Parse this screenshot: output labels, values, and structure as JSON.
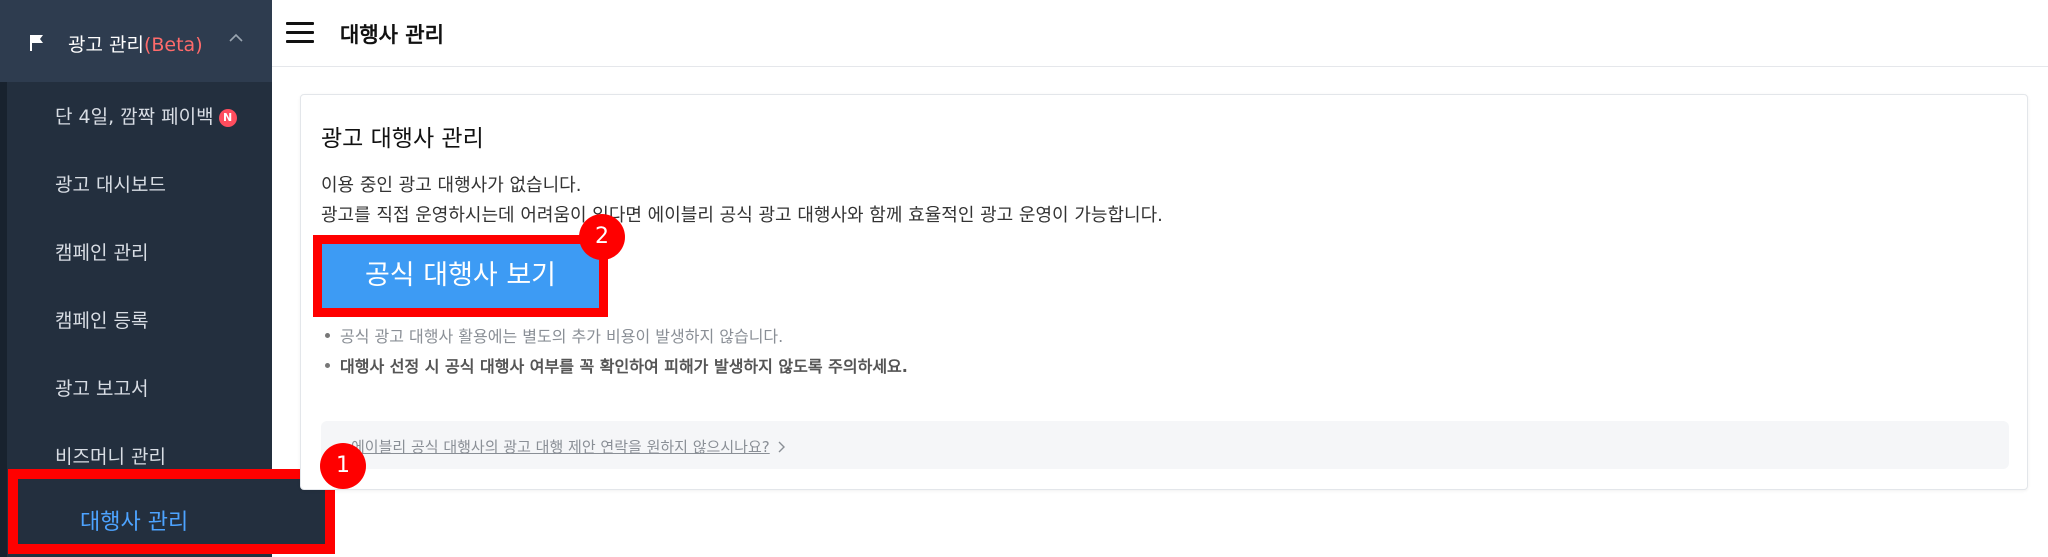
{
  "sidebar": {
    "section_title": "광고 관리",
    "section_badge": "(Beta)",
    "items": [
      {
        "label": "단 4일, 깜짝 페이백",
        "badge": "N"
      },
      {
        "label": "광고 대시보드"
      },
      {
        "label": "캠페인 관리"
      },
      {
        "label": "캠페인 등록"
      },
      {
        "label": "광고 보고서"
      },
      {
        "label": "비즈머니 관리"
      }
    ],
    "active_item": "대행사 관리"
  },
  "header": {
    "title": "대행사 관리"
  },
  "card": {
    "title": "광고 대행사 관리",
    "desc_line1": "이용 중인 광고 대행사가 없습니다.",
    "desc_line2": "광고를 직접 운영하시는데 어려움이 있다면 에이블리 공식 광고 대행사와 함께 효율적인 광고 운영이 가능합니다.",
    "button_label": "공식 대행사 보기",
    "notes": [
      "공식 광고 대행사 활용에는 별도의 추가 비용이 발생하지 않습니다.",
      "대행사 선정 시 공식 대행사 여부를 꼭 확인하여 피해가 발생하지 않도록 주의하세요."
    ],
    "contact_link": "에이블리 공식 대행사의 광고 대행 제안 연락을 원하지 않으시나요?"
  },
  "annotations": {
    "step1": "1",
    "step2": "2"
  },
  "colors": {
    "sidebar_bg": "#232f3e",
    "accent_blue": "#3d9bf4",
    "highlight_red": "#ff0000",
    "beta_red": "#ff6b6b"
  }
}
